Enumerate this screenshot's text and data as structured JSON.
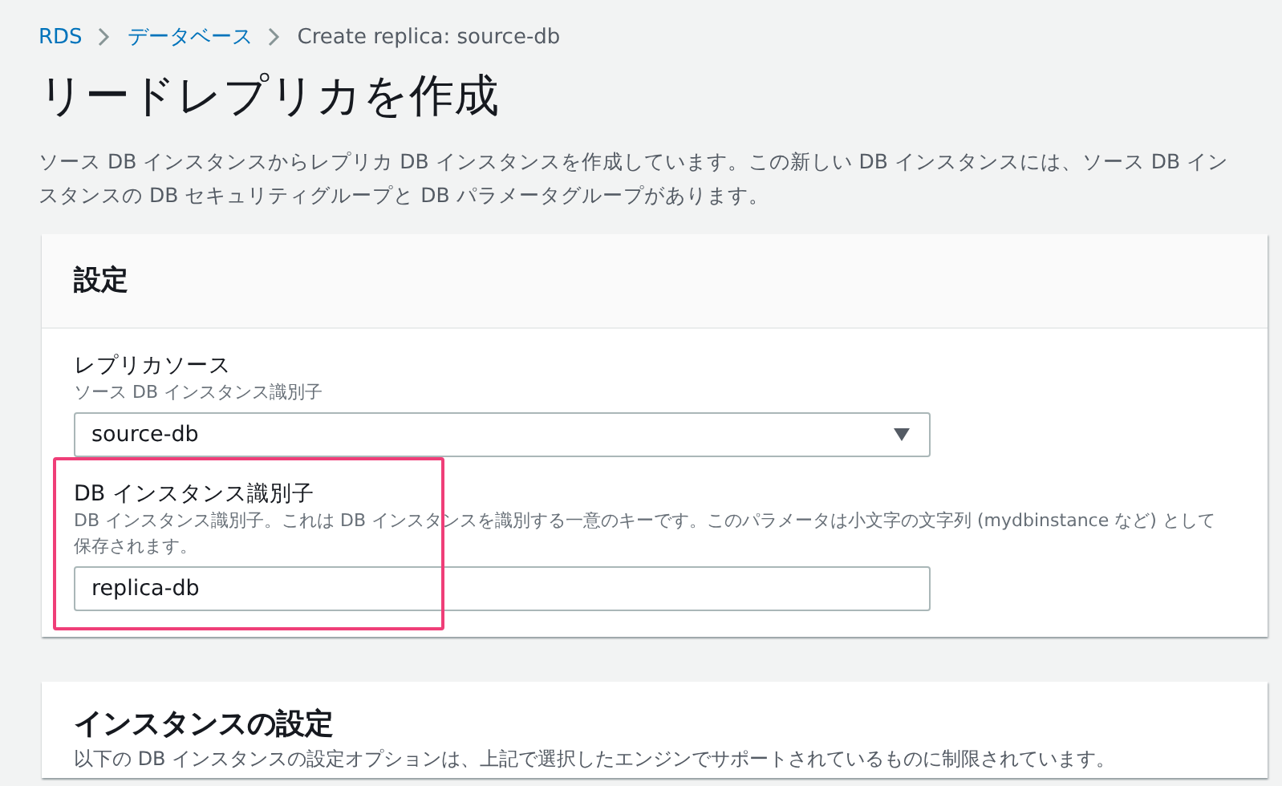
{
  "breadcrumb": [
    {
      "label": "RDS",
      "link": true
    },
    {
      "label": "データベース",
      "link": true
    },
    {
      "label": "Create replica: source-db",
      "link": false
    }
  ],
  "title": "リードレプリカを作成",
  "description": "ソース DB インスタンスからレプリカ DB インスタンスを作成しています。この新しい DB インスタンスには、ソース DB インスタンスの DB セキュリティグループと DB パラメータグループがあります。",
  "settings_panel": {
    "heading": "設定",
    "fields": [
      {
        "kind": "select",
        "label": "レプリカソース",
        "hint": "ソース DB インスタンス識別子",
        "value": "source-db",
        "highlighted": false
      },
      {
        "kind": "text",
        "label": "DB インスタンス識別子",
        "hint": "DB インスタンス識別子。これは DB インスタンスを識別する一意のキーです。このパラメータは小文字の文字列 (mydbinstance など) として保存されます。",
        "value": "replica-db",
        "highlighted": true
      }
    ]
  },
  "instance_panel": {
    "heading": "インスタンスの設定",
    "description": "以下の DB インスタンスの設定オプションは、上記で選択したエンジンでサポートされているものに制限されています。"
  }
}
